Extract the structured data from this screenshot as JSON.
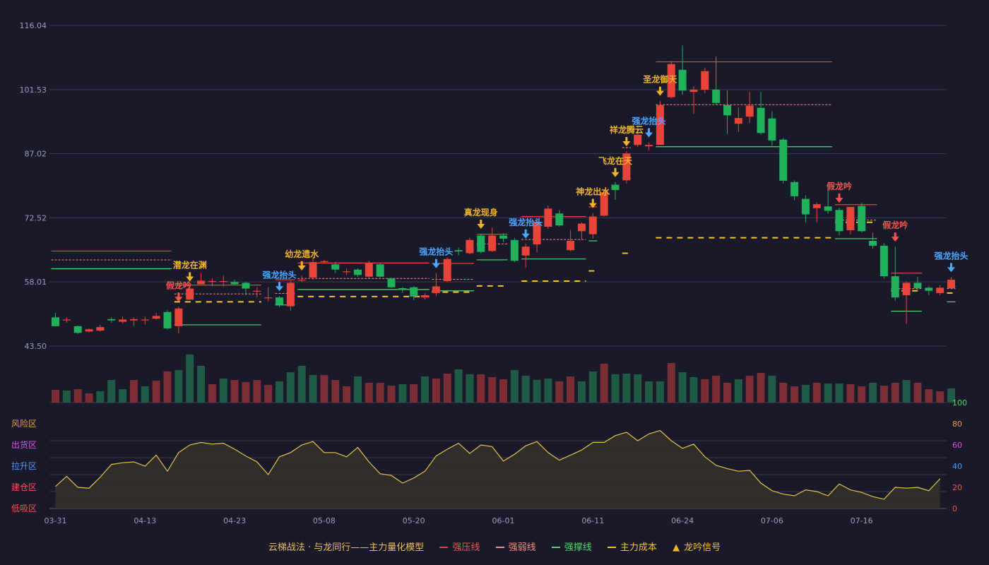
{
  "colors": {
    "background": "#19192a",
    "up": "#e8443a",
    "down": "#1fb15c",
    "grid": "#3a3c52",
    "axis_text": "#9aa0b4",
    "signal_gold": "#f0b429",
    "signal_blue": "#4aa8ff",
    "signal_red": "#f0564e",
    "strong_pressure": "#e8443a",
    "strong_weak": "#ff8a80",
    "strong_support": "#4ddb6a",
    "main_cost": "#f5c623",
    "indicator_line": "#e8c24a",
    "indicator_fill": "#34302a",
    "volume_up": "#7a2e33",
    "volume_down": "#1f5a45"
  },
  "legend": {
    "title": "云梯战法 · 与龙同行——主力量化模型",
    "strong_pressure": "强压线",
    "strong_weak": "强弱线",
    "strong_support": "强撑线",
    "main_cost": "主力成本",
    "signal": "龙吟信号"
  },
  "chart_data": {
    "type": "candlestick",
    "price_axis": {
      "ticks": [
        "116.04",
        "101.53",
        "87.02",
        "72.52",
        "58.01",
        "43.50"
      ],
      "range": [
        43.5,
        116.04
      ]
    },
    "date_labels": [
      "03-31",
      "04-13",
      "04-23",
      "05-08",
      "05-20",
      "06-01",
      "06-11",
      "06-24",
      "07-06",
      "07-16"
    ],
    "date_label_index": [
      0,
      8,
      16,
      24,
      32,
      40,
      48,
      56,
      64,
      72
    ],
    "candles": [
      [
        50,
        48,
        51,
        48
      ],
      [
        49.5,
        49.5,
        50,
        48.8
      ],
      [
        48,
        46.5,
        48.2,
        46.2
      ],
      [
        46.8,
        47.3,
        47.5,
        46.6
      ],
      [
        47,
        47.8,
        48.3,
        46.8
      ],
      [
        49.6,
        49.3,
        50,
        48.8
      ],
      [
        49,
        49.5,
        50.2,
        48.6
      ],
      [
        49.3,
        49.6,
        50,
        48
      ],
      [
        49.5,
        49.5,
        50.2,
        48.4
      ],
      [
        49.7,
        50.3,
        51,
        49.5
      ],
      [
        51.2,
        47.5,
        51.6,
        47.2
      ],
      [
        48,
        52,
        52.4,
        46.4
      ],
      [
        54,
        56.5,
        57,
        54
      ],
      [
        57.5,
        58.3,
        60,
        57.5
      ],
      [
        58,
        58.2,
        58.8,
        57
      ],
      [
        58,
        58.2,
        59.5,
        57
      ],
      [
        58,
        57.5,
        58.5,
        57.3
      ],
      [
        57.8,
        56.5,
        58,
        55
      ],
      [
        56,
        56,
        56.8,
        54.5
      ],
      [
        54.5,
        54.5,
        56.8,
        53.6
      ],
      [
        54.5,
        52.8,
        54.8,
        52.3
      ],
      [
        52.5,
        57.8,
        58.3,
        51.5
      ],
      [
        58.5,
        58.5,
        59.5,
        58
      ],
      [
        59,
        62.5,
        63.4,
        58.5
      ],
      [
        62.6,
        62.7,
        63,
        62.2
      ],
      [
        62,
        60.8,
        62.5,
        60
      ],
      [
        60.4,
        60.4,
        61,
        59.6
      ],
      [
        60.8,
        59.6,
        61.1,
        59.2
      ],
      [
        59.2,
        62.3,
        62.8,
        58.9
      ],
      [
        62,
        59.2,
        62.3,
        59
      ],
      [
        58.8,
        56.8,
        59,
        56.6
      ],
      [
        56.6,
        56.3,
        56.9,
        55.5
      ],
      [
        56.8,
        54.7,
        57.1,
        53.9
      ],
      [
        54.5,
        55,
        55.5,
        54
      ],
      [
        55.5,
        57,
        60,
        54.8
      ],
      [
        58.2,
        63.2,
        63.6,
        58
      ],
      [
        65.2,
        64.9,
        65.8,
        64
      ],
      [
        64.5,
        67.5,
        68,
        64.3
      ],
      [
        68.5,
        64.8,
        68.9,
        64.5
      ],
      [
        65,
        68.5,
        70.3,
        64.8
      ],
      [
        68.5,
        67.8,
        69,
        67
      ],
      [
        67.5,
        62.8,
        68,
        62.5
      ],
      [
        64,
        66,
        66.7,
        61.2
      ],
      [
        66.5,
        71.6,
        72.3,
        64.7
      ],
      [
        70.5,
        74.6,
        75.3,
        70
      ],
      [
        73.5,
        70.8,
        74.3,
        70.5
      ],
      [
        65.2,
        67.3,
        69.8,
        65
      ],
      [
        69.5,
        71.2,
        71.5,
        67.5
      ],
      [
        68.8,
        72.8,
        73.6,
        67.8
      ],
      [
        73,
        78.3,
        78.6,
        72.8
      ],
      [
        80,
        78.8,
        80.6,
        76.6
      ],
      [
        81,
        87.1,
        87.6,
        80.3
      ],
      [
        89,
        91.3,
        93.4,
        88.6
      ],
      [
        88.7,
        89,
        89.6,
        87.8
      ],
      [
        89,
        98,
        99,
        89.3
      ],
      [
        99.8,
        107.3,
        108,
        99.5
      ],
      [
        106,
        101.3,
        111.5,
        100.4
      ],
      [
        101,
        101.5,
        102.3,
        96
      ],
      [
        101.5,
        105.7,
        106.5,
        100.7
      ],
      [
        101.5,
        98.5,
        109,
        98
      ],
      [
        98,
        95.7,
        101.3,
        91.5
      ],
      [
        93.8,
        95.1,
        97.5,
        91.9
      ],
      [
        95.4,
        97.9,
        101,
        94
      ],
      [
        97.4,
        91.7,
        101,
        91.3
      ],
      [
        95,
        90,
        96.6,
        88.8
      ],
      [
        90.2,
        80.9,
        90.6,
        80.3
      ],
      [
        80.6,
        77.4,
        81,
        76.5
      ],
      [
        76.8,
        73.3,
        77.6,
        71.5
      ],
      [
        74.7,
        75.6,
        76,
        71.5
      ],
      [
        75.1,
        74.1,
        79.7,
        73.4
      ],
      [
        74.3,
        69.5,
        74.8,
        68.6
      ],
      [
        69.7,
        75,
        75,
        68.8
      ],
      [
        75.2,
        69.5,
        75.9,
        69.2
      ],
      [
        67.3,
        66.2,
        69.1,
        65.5
      ],
      [
        66.2,
        59.3,
        66.8,
        58.8
      ],
      [
        59.3,
        54.5,
        66,
        53.7
      ],
      [
        55,
        57.8,
        58.1,
        48.5
      ],
      [
        57.8,
        56.6,
        59.2,
        55.9
      ],
      [
        56.7,
        56,
        57,
        55
      ],
      [
        55.5,
        56.7,
        57.3,
        55
      ],
      [
        56.6,
        58.5,
        59.1,
        56.4
      ]
    ],
    "volume": [
      [
        18,
        1
      ],
      [
        17,
        0
      ],
      [
        19,
        1
      ],
      [
        13,
        1
      ],
      [
        16,
        0
      ],
      [
        32,
        0
      ],
      [
        19,
        0
      ],
      [
        32,
        1
      ],
      [
        23,
        0
      ],
      [
        31,
        1
      ],
      [
        44,
        1
      ],
      [
        46,
        0
      ],
      [
        68,
        0
      ],
      [
        52,
        0
      ],
      [
        26,
        1
      ],
      [
        34,
        0
      ],
      [
        32,
        1
      ],
      [
        29,
        1
      ],
      [
        32,
        1
      ],
      [
        25,
        1
      ],
      [
        30,
        0
      ],
      [
        43,
        0
      ],
      [
        52,
        0
      ],
      [
        39,
        0
      ],
      [
        39,
        1
      ],
      [
        32,
        1
      ],
      [
        23,
        1
      ],
      [
        37,
        0
      ],
      [
        28,
        1
      ],
      [
        28,
        1
      ],
      [
        24,
        1
      ],
      [
        26,
        0
      ],
      [
        26,
        1
      ],
      [
        37,
        0
      ],
      [
        34,
        1
      ],
      [
        41,
        1
      ],
      [
        47,
        0
      ],
      [
        40,
        0
      ],
      [
        40,
        1
      ],
      [
        36,
        1
      ],
      [
        33,
        1
      ],
      [
        46,
        0
      ],
      [
        38,
        0
      ],
      [
        32,
        0
      ],
      [
        34,
        0
      ],
      [
        30,
        1
      ],
      [
        37,
        1
      ],
      [
        30,
        0
      ],
      [
        44,
        0
      ],
      [
        55,
        1
      ],
      [
        40,
        0
      ],
      [
        41,
        0
      ],
      [
        40,
        0
      ],
      [
        30,
        0
      ],
      [
        30,
        0
      ],
      [
        56,
        1
      ],
      [
        43,
        0
      ],
      [
        36,
        0
      ],
      [
        33,
        1
      ],
      [
        38,
        1
      ],
      [
        28,
        1
      ],
      [
        33,
        0
      ],
      [
        38,
        1
      ],
      [
        42,
        1
      ],
      [
        38,
        0
      ],
      [
        28,
        1
      ],
      [
        23,
        1
      ],
      [
        25,
        0
      ],
      [
        28,
        1
      ],
      [
        27,
        0
      ],
      [
        27,
        0
      ],
      [
        26,
        1
      ],
      [
        23,
        1
      ],
      [
        28,
        0
      ],
      [
        24,
        1
      ],
      [
        28,
        1
      ],
      [
        32,
        0
      ],
      [
        28,
        1
      ],
      [
        19,
        1
      ],
      [
        16,
        1
      ],
      [
        20,
        0
      ]
    ],
    "indicator": {
      "left_labels": [
        "风险区",
        "出货区",
        "拉升区",
        "建仓区",
        "低吸区"
      ],
      "left_label_colors": [
        "#e8a030",
        "#e050e8",
        "#4a9cff",
        "#f0564e",
        "#f0564e"
      ],
      "right_ticks": [
        "100",
        "80",
        "60",
        "40",
        "20",
        "0"
      ],
      "right_tick_colors": [
        "#4ddb6a",
        "#e8a030",
        "#e050e8",
        "#4a9cff",
        "#f0564e",
        "#f0564e"
      ],
      "values": [
        26,
        38,
        25,
        24,
        37,
        52,
        54,
        55,
        50,
        63,
        44,
        66,
        75,
        78,
        76,
        77,
        70,
        62,
        55,
        40,
        61,
        66,
        75,
        79,
        66,
        66,
        61,
        72,
        55,
        41,
        39,
        30,
        36,
        44,
        62,
        70,
        77,
        65,
        75,
        73,
        56,
        64,
        74,
        79,
        66,
        57,
        63,
        69,
        78,
        78,
        86,
        90,
        80,
        88,
        92,
        80,
        71,
        76,
        61,
        51,
        47,
        44,
        45,
        30,
        21,
        17,
        15,
        22,
        20,
        15,
        29,
        22,
        19,
        14,
        11,
        25,
        24,
        25,
        21,
        35
      ]
    },
    "signals": [
      {
        "i": 11,
        "label": "假龙吟",
        "color": "red",
        "pos": "above_high"
      },
      {
        "i": 12,
        "label": "潜龙在渊",
        "color": "gold",
        "pos": "above_high"
      },
      {
        "i": 20,
        "label": "强龙抬头",
        "color": "blue",
        "pos": "above_high"
      },
      {
        "i": 22,
        "label": "幼龙遗水",
        "color": "gold",
        "pos": "above_high"
      },
      {
        "i": 34,
        "label": "强龙抬头",
        "color": "blue",
        "pos": "above_high"
      },
      {
        "i": 38,
        "label": "真龙现身",
        "color": "gold",
        "pos": "above_high"
      },
      {
        "i": 42,
        "label": "强龙抬头",
        "color": "blue",
        "pos": "above_high"
      },
      {
        "i": 48,
        "label": "神龙出水",
        "color": "gold",
        "pos": "above_high"
      },
      {
        "i": 50,
        "label": "飞龙在天",
        "color": "gold",
        "pos": "above_high"
      },
      {
        "i": 51,
        "label": "祥龙腾云",
        "color": "gold",
        "pos": "above_high"
      },
      {
        "i": 53,
        "label": "强龙抬头",
        "color": "blue",
        "pos": "above_high"
      },
      {
        "i": 54,
        "label": "圣龙御天",
        "color": "gold",
        "pos": "above_high"
      },
      {
        "i": 70,
        "label": "假龙吟",
        "color": "red",
        "pos": "above_high"
      },
      {
        "i": 75,
        "label": "假龙吟",
        "color": "red",
        "pos": "above_high"
      },
      {
        "i": 80,
        "label": "强龙抬头",
        "color": "blue",
        "pos": "above_high"
      }
    ],
    "segments": [
      {
        "kind": "pressure",
        "from": 0,
        "to": 10,
        "y": 65
      },
      {
        "kind": "weak",
        "from": 0,
        "to": 10,
        "y": 63
      },
      {
        "kind": "support",
        "from": 0,
        "to": 10,
        "y": 61
      },
      {
        "kind": "pressure",
        "from": 11,
        "to": 18,
        "y": 57.3
      },
      {
        "kind": "weak",
        "from": 11,
        "to": 18,
        "y": 55.3
      },
      {
        "kind": "support",
        "from": 11,
        "to": 18,
        "y": 48.3
      },
      {
        "kind": "cost",
        "from": 11,
        "to": 18,
        "y": 53.5
      },
      {
        "kind": "pressure",
        "from": 20,
        "to": 21,
        "y": 58.5
      },
      {
        "kind": "weak",
        "from": 20,
        "to": 21,
        "y": 55.4
      },
      {
        "kind": "support",
        "from": 20,
        "to": 21,
        "y": 52.8
      },
      {
        "kind": "pressure",
        "from": 22,
        "to": 33,
        "y": 62.3
      },
      {
        "kind": "weak",
        "from": 22,
        "to": 33,
        "y": 58.8
      },
      {
        "kind": "support",
        "from": 22,
        "to": 33,
        "y": 56.3
      },
      {
        "kind": "cost",
        "from": 22,
        "to": 33,
        "y": 54.7
      },
      {
        "kind": "pressure",
        "from": 34,
        "to": 37,
        "y": 62.2
      },
      {
        "kind": "weak",
        "from": 34,
        "to": 37,
        "y": 58.6
      },
      {
        "kind": "support",
        "from": 34,
        "to": 37,
        "y": 56
      },
      {
        "kind": "cost",
        "from": 34,
        "to": 37,
        "y": 55.7
      },
      {
        "kind": "pressure",
        "from": 38,
        "to": 40,
        "y": 68.8
      },
      {
        "kind": "weak",
        "from": 38,
        "to": 40,
        "y": 66.6
      },
      {
        "kind": "support",
        "from": 38,
        "to": 40,
        "y": 63
      },
      {
        "kind": "cost",
        "from": 38,
        "to": 40,
        "y": 57.1
      },
      {
        "kind": "pressure",
        "from": 42,
        "to": 47,
        "y": 72.8
      },
      {
        "kind": "weak",
        "from": 42,
        "to": 47,
        "y": 67.6
      },
      {
        "kind": "support",
        "from": 42,
        "to": 47,
        "y": 63.2
      },
      {
        "kind": "cost",
        "from": 42,
        "to": 47,
        "y": 58.2
      },
      {
        "kind": "pressure",
        "from": 48,
        "to": 48,
        "y": 75
      },
      {
        "kind": "support",
        "from": 48,
        "to": 48,
        "y": 67.3
      },
      {
        "kind": "cost",
        "from": 48,
        "to": 48,
        "y": 60.5
      },
      {
        "kind": "pressure",
        "from": 51,
        "to": 51,
        "y": 92.8
      },
      {
        "kind": "weak",
        "from": 51,
        "to": 51,
        "y": 88.4
      },
      {
        "kind": "support",
        "from": 51,
        "to": 51,
        "y": 81.5
      },
      {
        "kind": "cost",
        "from": 51,
        "to": 51,
        "y": 64.5
      },
      {
        "kind": "pressure",
        "from": 54,
        "to": 69,
        "y": 107.8
      },
      {
        "kind": "weak",
        "from": 54,
        "to": 69,
        "y": 98.1
      },
      {
        "kind": "support",
        "from": 54,
        "to": 69,
        "y": 88.6
      },
      {
        "kind": "cost",
        "from": 54,
        "to": 69,
        "y": 68
      },
      {
        "kind": "pressure",
        "from": 70,
        "to": 73,
        "y": 75.5
      },
      {
        "kind": "weak",
        "from": 70,
        "to": 73,
        "y": 72
      },
      {
        "kind": "support",
        "from": 70,
        "to": 73,
        "y": 67.8
      },
      {
        "kind": "cost",
        "from": 70,
        "to": 73,
        "y": 71.5
      },
      {
        "kind": "pressure",
        "from": 75,
        "to": 77,
        "y": 60
      },
      {
        "kind": "weak",
        "from": 75,
        "to": 77,
        "y": 56.5
      },
      {
        "kind": "support",
        "from": 75,
        "to": 77,
        "y": 51.4
      },
      {
        "kind": "cost",
        "from": 75,
        "to": 77,
        "y": 56
      },
      {
        "kind": "pressure",
        "from": 80,
        "to": 80,
        "y": 57
      },
      {
        "kind": "weak",
        "from": 80,
        "to": 80,
        "y": 56.5
      },
      {
        "kind": "support",
        "from": 80,
        "to": 80,
        "y": 53.5
      },
      {
        "kind": "cost",
        "from": 80,
        "to": 80,
        "y": 55.5
      }
    ]
  }
}
